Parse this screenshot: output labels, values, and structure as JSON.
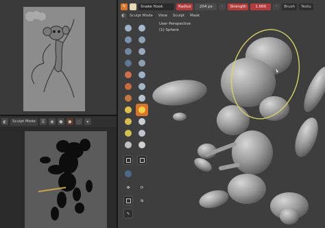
{
  "viewport": {
    "tool_name": "Snake Hook",
    "radius_label": "Radius",
    "radius_value": "204 px",
    "strength_label": "Strength",
    "strength_value": "1.000",
    "brush_menu": "Brush",
    "texture_menu": "Textu",
    "menu": [
      "Sculpt Mode",
      "View",
      "Sculpt",
      "Mask"
    ],
    "perspective_text": "User Perspective",
    "object_text": "(1) Sphere"
  },
  "bottom_pane": {
    "mode_label": "Sculpt Mode"
  },
  "colors": {
    "accent_orange": "#d7752c",
    "radius_red": "#b33b3b",
    "brush_circle": "#d8d466"
  },
  "icons": [
    "brush-tool-icon",
    "sculpt-mode-icon",
    "hamburger-menu-icon",
    "move-gizmo-icon",
    "rotate-gizmo-icon",
    "scale-gizmo-icon",
    "transform-icon",
    "annotate-icon"
  ]
}
